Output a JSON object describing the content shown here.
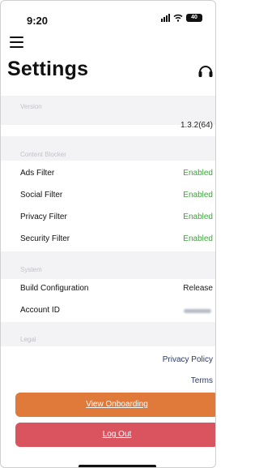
{
  "status_bar": {
    "time": "9:20",
    "battery": "40"
  },
  "header": {
    "title": "Settings"
  },
  "sections": {
    "version": {
      "label": "Version",
      "value": "1.3.2(64)"
    },
    "content_blocker": {
      "label": "Content Blocker",
      "rows": [
        {
          "label": "Ads Filter",
          "value": "Enabled"
        },
        {
          "label": "Social Filter",
          "value": "Enabled"
        },
        {
          "label": "Privacy Filter",
          "value": "Enabled"
        },
        {
          "label": "Security Filter",
          "value": "Enabled"
        }
      ]
    },
    "system": {
      "label": "System",
      "build_configuration": {
        "label": "Build Configuration",
        "value": "Release"
      },
      "account_id": {
        "label": "Account ID"
      }
    },
    "legal": {
      "label": "Legal",
      "privacy_policy": "Privacy Policy",
      "terms": "Terms"
    }
  },
  "buttons": {
    "view_onboarding": "View Onboarding",
    "log_out": "Log Out"
  },
  "colors": {
    "enabled": "#3da33d",
    "onboarding_button": "#df7a3a",
    "logout_button": "#d9545e",
    "section_background": "#f3f3f6"
  }
}
